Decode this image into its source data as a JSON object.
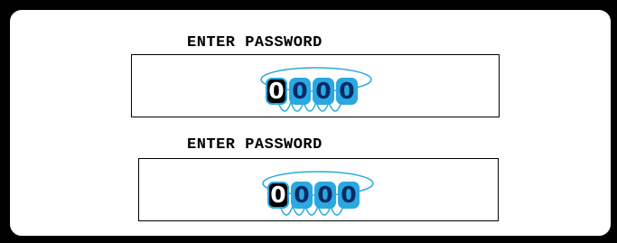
{
  "colors": {
    "background": "#000000",
    "panel": "#ffffff",
    "accent": "#2aa8df",
    "digit_text": "#0a2a66",
    "active_digit_bg": "#000000"
  },
  "password_fields": [
    {
      "label": "ENTER PASSWORD",
      "digits": [
        "0",
        "0",
        "0",
        "0"
      ],
      "active_index": 0
    },
    {
      "label": "ENTER PASSWORD",
      "digits": [
        "0",
        "0",
        "0",
        "0"
      ],
      "active_index": 0
    }
  ]
}
